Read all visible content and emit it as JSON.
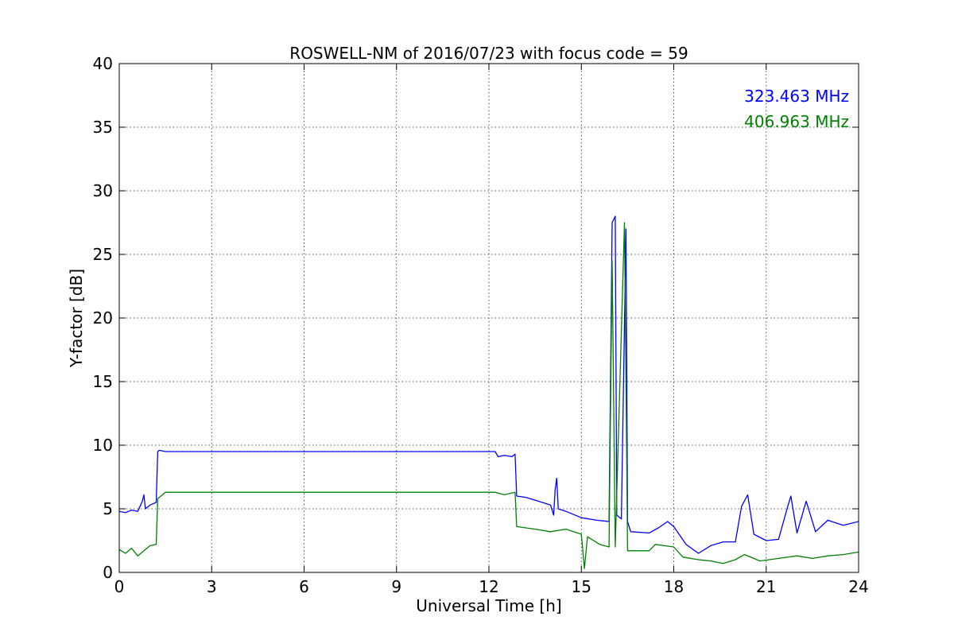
{
  "chart_data": {
    "type": "line",
    "title": "ROSWELL-NM of 2016/07/23 with focus code = 59",
    "xlabel": "Universal Time [h]",
    "ylabel": "Y-factor [dB]",
    "xlim": [
      0,
      24
    ],
    "ylim": [
      0,
      40
    ],
    "xticks": [
      0,
      3,
      6,
      9,
      12,
      15,
      18,
      21,
      24
    ],
    "yticks": [
      0,
      5,
      10,
      15,
      20,
      25,
      30,
      35,
      40
    ],
    "xtick_labels": [
      "0",
      "3",
      "6",
      "9",
      "12",
      "15",
      "18",
      "21",
      "24"
    ],
    "ytick_labels": [
      "0",
      "5",
      "10",
      "15",
      "20",
      "25",
      "30",
      "35",
      "40"
    ],
    "grid": true,
    "legend_position": "top-right",
    "series": [
      {
        "name": "323.463 MHz",
        "color": "#0000ff",
        "points": [
          [
            0.0,
            4.8
          ],
          [
            0.2,
            4.7
          ],
          [
            0.4,
            4.9
          ],
          [
            0.6,
            4.8
          ],
          [
            0.75,
            5.6
          ],
          [
            0.8,
            6.1
          ],
          [
            0.85,
            5.0
          ],
          [
            1.0,
            5.3
          ],
          [
            1.2,
            5.5
          ],
          [
            1.25,
            9.5
          ],
          [
            1.3,
            9.6
          ],
          [
            1.5,
            9.5
          ],
          [
            3.0,
            9.5
          ],
          [
            6.0,
            9.5
          ],
          [
            9.0,
            9.5
          ],
          [
            12.2,
            9.5
          ],
          [
            12.3,
            9.1
          ],
          [
            12.5,
            9.2
          ],
          [
            12.75,
            9.1
          ],
          [
            12.85,
            9.3
          ],
          [
            12.9,
            6.0
          ],
          [
            13.2,
            5.9
          ],
          [
            13.6,
            5.6
          ],
          [
            14.0,
            5.3
          ],
          [
            14.1,
            4.5
          ],
          [
            14.15,
            6.5
          ],
          [
            14.2,
            7.4
          ],
          [
            14.25,
            5.0
          ],
          [
            14.5,
            4.8
          ],
          [
            15.0,
            4.3
          ],
          [
            15.5,
            4.1
          ],
          [
            15.9,
            4.0
          ],
          [
            16.0,
            27.5
          ],
          [
            16.1,
            28.0
          ],
          [
            16.15,
            4.5
          ],
          [
            16.3,
            4.2
          ],
          [
            16.45,
            27.0
          ],
          [
            16.5,
            4.0
          ],
          [
            16.6,
            3.2
          ],
          [
            17.2,
            3.1
          ],
          [
            17.5,
            3.5
          ],
          [
            17.8,
            4.0
          ],
          [
            18.0,
            3.6
          ],
          [
            18.4,
            2.2
          ],
          [
            18.8,
            1.5
          ],
          [
            19.2,
            2.1
          ],
          [
            19.6,
            2.4
          ],
          [
            20.0,
            2.4
          ],
          [
            20.2,
            5.2
          ],
          [
            20.4,
            6.1
          ],
          [
            20.6,
            3.0
          ],
          [
            21.0,
            2.5
          ],
          [
            21.4,
            2.6
          ],
          [
            21.7,
            5.2
          ],
          [
            21.8,
            6.0
          ],
          [
            22.0,
            3.1
          ],
          [
            22.3,
            5.6
          ],
          [
            22.6,
            3.2
          ],
          [
            23.0,
            4.1
          ],
          [
            23.5,
            3.7
          ],
          [
            24.0,
            4.0
          ]
        ]
      },
      {
        "name": "406.963 MHz",
        "color": "#008000",
        "points": [
          [
            0.0,
            1.8
          ],
          [
            0.2,
            1.5
          ],
          [
            0.4,
            1.9
          ],
          [
            0.6,
            1.3
          ],
          [
            0.8,
            1.7
          ],
          [
            1.0,
            2.1
          ],
          [
            1.2,
            2.2
          ],
          [
            1.25,
            5.8
          ],
          [
            1.5,
            6.3
          ],
          [
            3.0,
            6.3
          ],
          [
            6.0,
            6.3
          ],
          [
            9.0,
            6.3
          ],
          [
            12.2,
            6.3
          ],
          [
            12.5,
            6.1
          ],
          [
            12.85,
            6.3
          ],
          [
            12.9,
            3.6
          ],
          [
            13.5,
            3.4
          ],
          [
            14.0,
            3.2
          ],
          [
            14.5,
            3.4
          ],
          [
            15.0,
            3.0
          ],
          [
            15.1,
            0.3
          ],
          [
            15.2,
            2.8
          ],
          [
            15.6,
            2.2
          ],
          [
            15.9,
            2.0
          ],
          [
            16.0,
            24.5
          ],
          [
            16.1,
            2.0
          ],
          [
            16.4,
            27.5
          ],
          [
            16.5,
            1.7
          ],
          [
            17.2,
            1.7
          ],
          [
            17.4,
            2.2
          ],
          [
            18.0,
            2.0
          ],
          [
            18.3,
            1.2
          ],
          [
            18.8,
            1.0
          ],
          [
            19.2,
            0.9
          ],
          [
            19.6,
            0.7
          ],
          [
            20.0,
            1.0
          ],
          [
            20.3,
            1.4
          ],
          [
            20.8,
            0.9
          ],
          [
            21.4,
            1.1
          ],
          [
            22.0,
            1.3
          ],
          [
            22.5,
            1.1
          ],
          [
            23.0,
            1.3
          ],
          [
            23.5,
            1.4
          ],
          [
            24.0,
            1.6
          ]
        ]
      }
    ]
  }
}
